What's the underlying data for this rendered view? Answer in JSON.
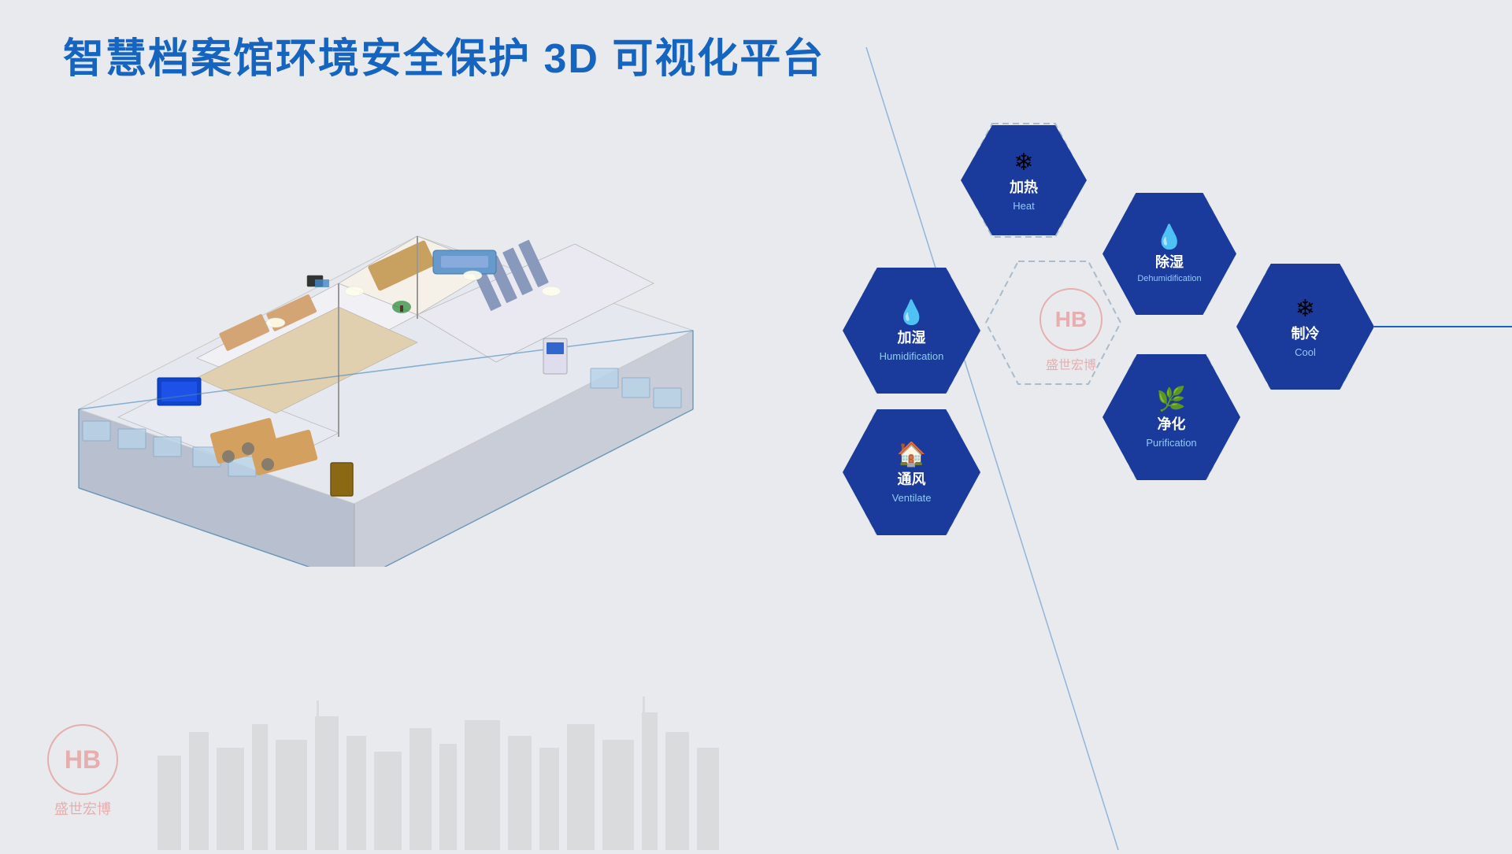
{
  "title": "智慧档案馆环境安全保护 3D 可视化平台",
  "brand": {
    "logo_symbol": "HB",
    "logo_text": "盛世宏博"
  },
  "hexagons": [
    {
      "id": "heat",
      "label_cn": "加热",
      "label_en": "Heat",
      "icon": "❄",
      "filled": true,
      "col": 1,
      "row": 0
    },
    {
      "id": "dehumidification",
      "label_cn": "除湿",
      "label_en": "Dehumidification",
      "icon": "💧",
      "filled": true,
      "col": 2,
      "row": 0
    },
    {
      "id": "humidification",
      "label_cn": "加湿",
      "label_en": "Humidification",
      "icon": "💧",
      "filled": true,
      "col": 0,
      "row": 1
    },
    {
      "id": "cool",
      "label_cn": "制冷",
      "label_en": "Cool",
      "icon": "❄",
      "filled": true,
      "col": 2,
      "row": 1
    },
    {
      "id": "purification",
      "label_cn": "净化",
      "label_en": "Purification",
      "icon": "🌿",
      "filled": true,
      "col": 1,
      "row": 2
    },
    {
      "id": "ventilate",
      "label_cn": "通风",
      "label_en": "Ventilate",
      "icon": "🏠",
      "filled": true,
      "col": 0,
      "row": 2
    }
  ],
  "connection_line": "→"
}
